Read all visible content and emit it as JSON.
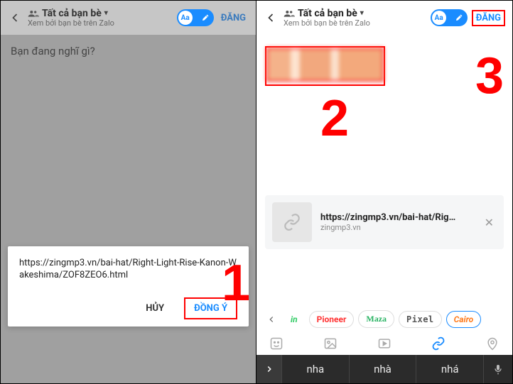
{
  "left": {
    "header": {
      "title": "Tất cả bạn bè",
      "subtitle": "Xem bởi bạn bè trên Zalo",
      "postLabel": "ĐĂNG",
      "aaLabel": "Aa"
    },
    "composer": {
      "placeholder": "Bạn đang nghĩ gì?"
    },
    "dialog": {
      "url": "https://zingmp3.vn/bai-hat/Right-Light-Rise-Kanon-Wakeshima/ZOF8ZEO6.html",
      "cancel": "HỦY",
      "confirm": "ĐỒNG Ý"
    }
  },
  "right": {
    "header": {
      "title": "Tất cả bạn bè",
      "subtitle": "Xem bởi bạn bè trên Zalo",
      "postLabel": "ĐĂNG",
      "aaLabel": "Aa"
    },
    "linkCard": {
      "title": "https://zingmp3.vn/bai-hat/Rig…",
      "domain": "zingmp3.vn"
    },
    "fonts": {
      "in": "in",
      "pioneer": "Pioneer",
      "maza": "Maza",
      "pixel": "Pixel",
      "cairo": "Cairo"
    },
    "keyboard": {
      "suggestions": [
        "nha",
        "nhà",
        "nhá"
      ]
    }
  },
  "annotations": {
    "n1": "1",
    "n2": "2",
    "n3": "3"
  }
}
